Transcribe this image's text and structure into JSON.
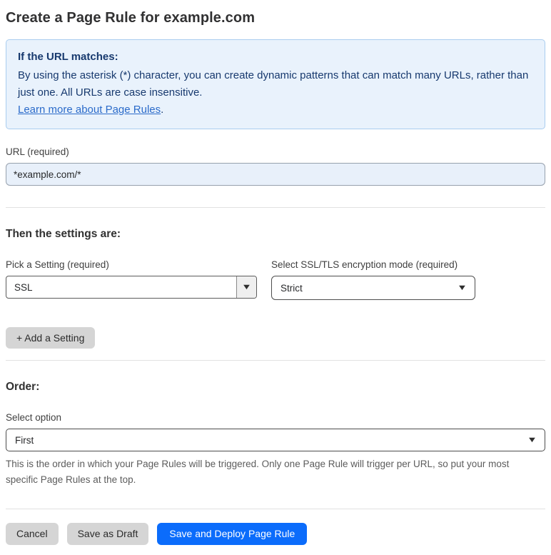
{
  "page": {
    "title": "Create a Page Rule for example.com"
  },
  "info_box": {
    "heading": "If the URL matches:",
    "body": "By using the asterisk (*) character, you can create dynamic patterns that can match many URLs, rather than just one. All URLs are case insensitive.",
    "link_label": "Learn more about Page Rules",
    "link_suffix": "."
  },
  "url_field": {
    "label": "URL (required)",
    "value": "*example.com/*"
  },
  "settings_section": {
    "heading": "Then the settings are:",
    "setting_picker": {
      "label": "Pick a Setting (required)",
      "value": "SSL"
    },
    "ssl_mode_picker": {
      "label": "Select SSL/TLS encryption mode (required)",
      "value": "Strict"
    },
    "add_setting_label": "+ Add a Setting"
  },
  "order_section": {
    "heading": "Order:",
    "select_label": "Select option",
    "value": "First",
    "help_text": "This is the order in which your Page Rules will be triggered. Only one Page Rule will trigger per URL, so put your most specific Page Rules at the top."
  },
  "footer": {
    "cancel_label": "Cancel",
    "save_draft_label": "Save as Draft",
    "save_deploy_label": "Save and Deploy Page Rule"
  },
  "icons": {
    "dropdown_arrow": "▼"
  },
  "colors": {
    "accent_blue": "#0b6cfb",
    "info_bg": "#e9f2fc",
    "info_border": "#a9ccef",
    "info_text": "#17396e",
    "link_blue": "#2b6bca",
    "input_bg": "#e8f0fa",
    "button_gray": "#d5d5d5"
  }
}
